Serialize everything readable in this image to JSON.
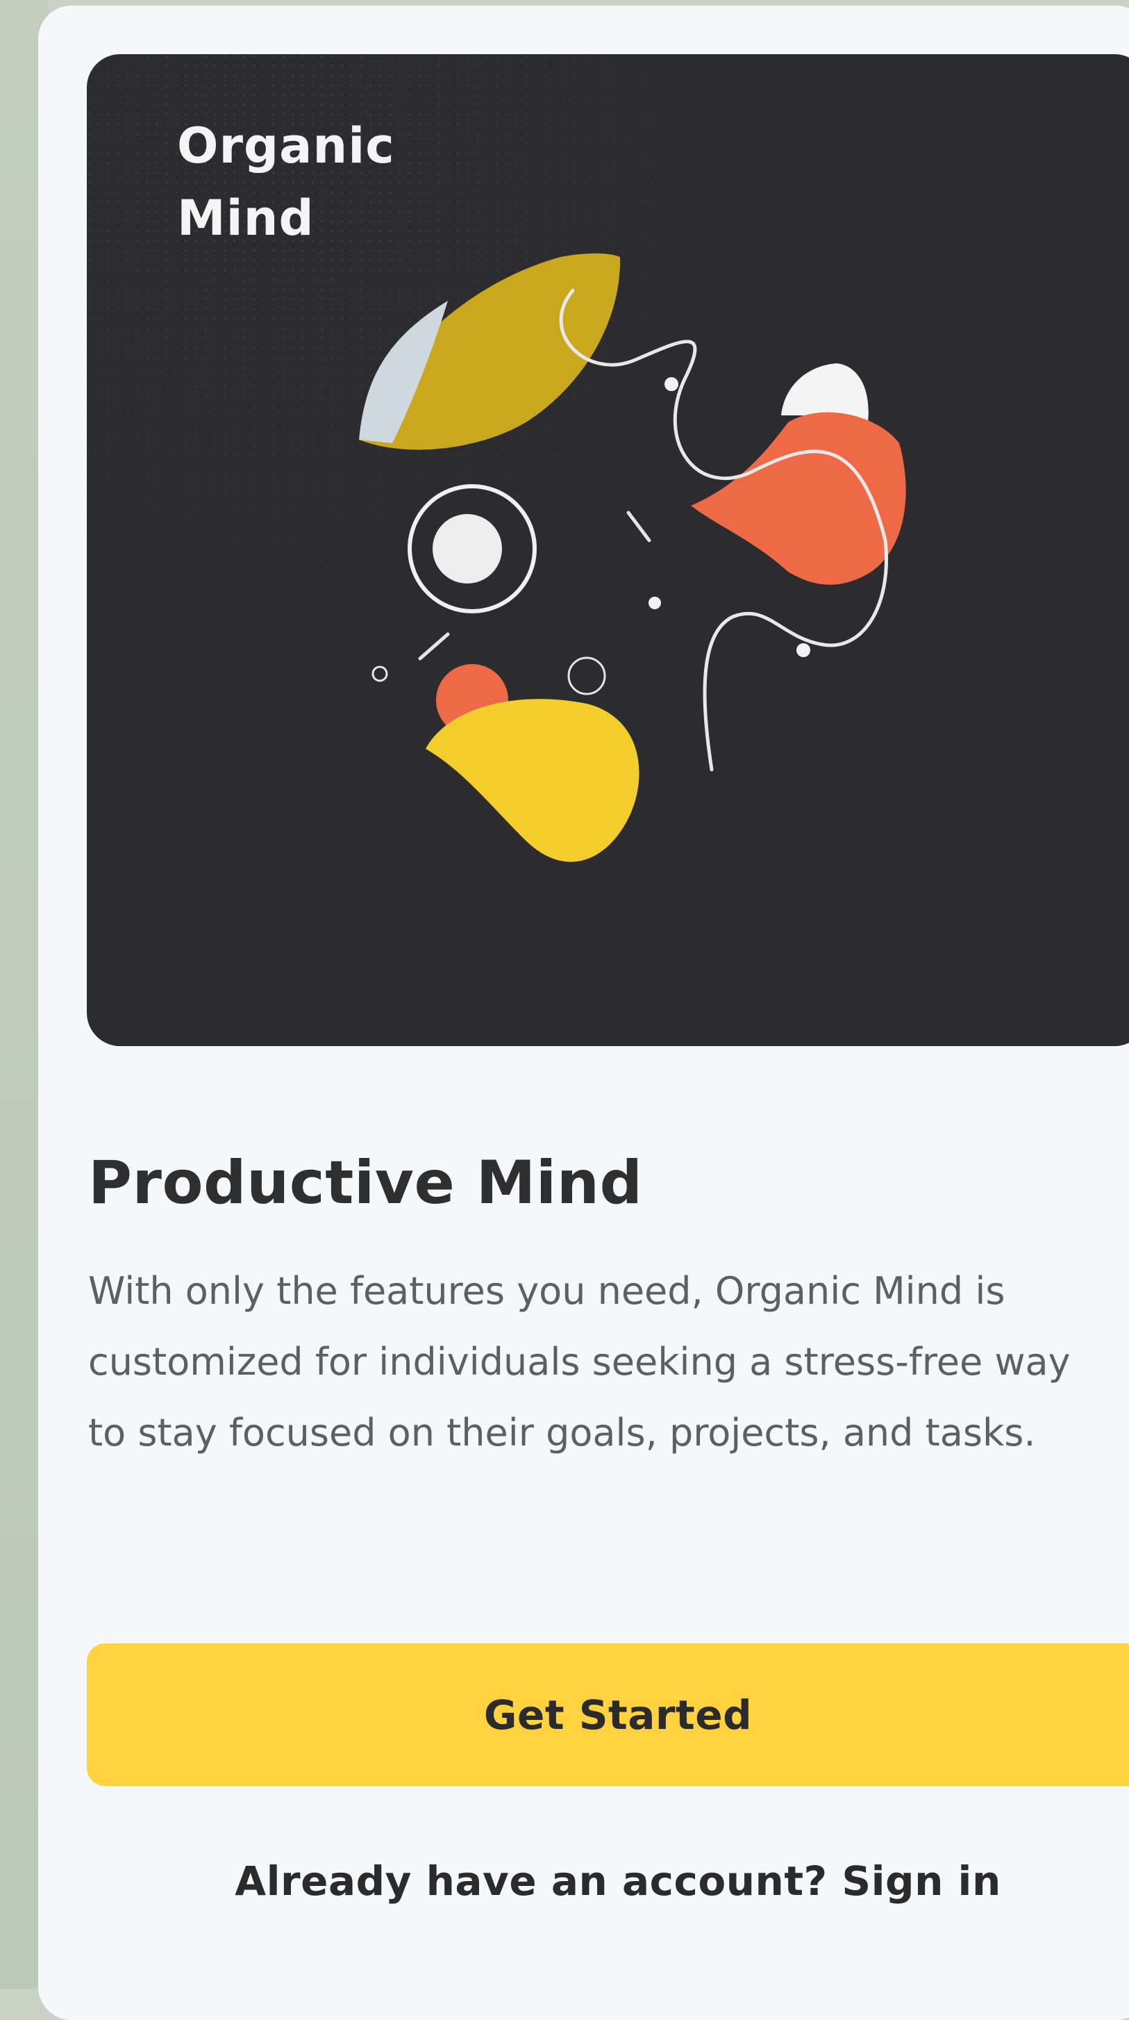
{
  "hero": {
    "brand_line1": "Organic",
    "brand_line2": "Mind"
  },
  "content": {
    "title": "Productive Mind",
    "description": "With only the features you need, Organic Mind is customized for individuals seeking a stress-free way to stay focused on their goals, projects, and tasks."
  },
  "actions": {
    "get_started_label": "Get Started",
    "signin_prompt": "Already have an account?",
    "signin_link": "Sign in"
  },
  "colors": {
    "background": "#c9d3c5",
    "card": "#f6f7f8",
    "hero": "#2c2c2e",
    "accent_yellow": "#ffd33f",
    "shape_mustard": "#c9a81e",
    "shape_coral": "#ee6a47",
    "shape_yellow": "#f3cd2c"
  }
}
